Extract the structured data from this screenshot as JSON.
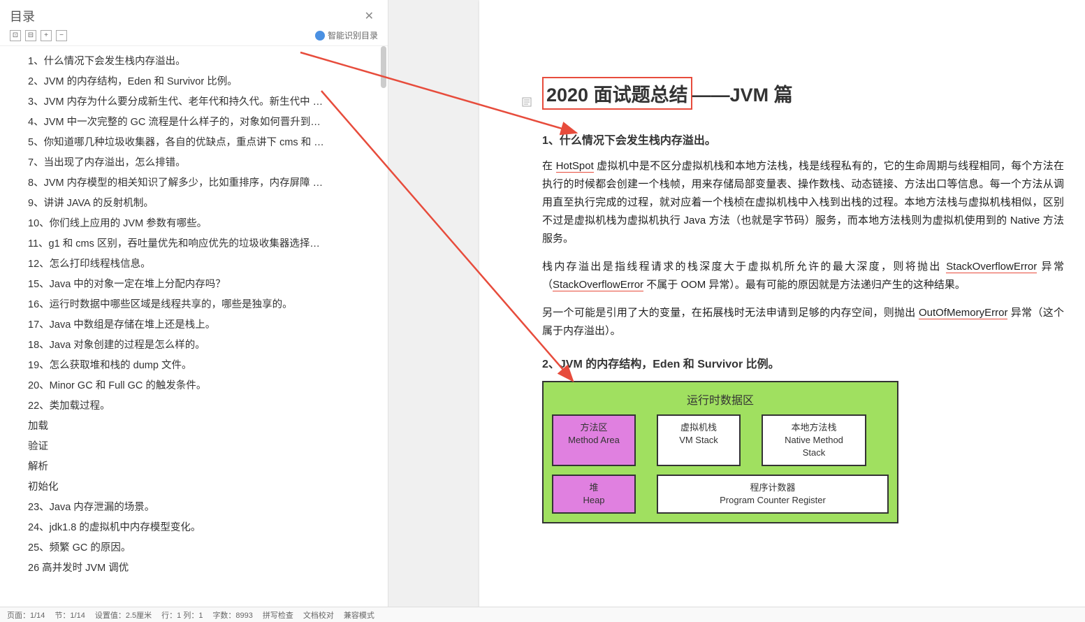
{
  "sidebar": {
    "title": "目录",
    "close": "✕",
    "expand_all": "⊡",
    "collapse_all": "⊟",
    "plus": "+",
    "minus": "−",
    "smart_toc": "智能识别目录",
    "items": [
      "1、什么情况下会发生栈内存溢出。",
      "2、JVM 的内存结构，Eden 和 Survivor 比例。",
      "3、JVM 内存为什么要分成新生代、老年代和持久代。新生代中 …",
      "4、JVM 中一次完整的 GC 流程是什么样子的，对象如何晋升到…",
      "5、你知道哪几种垃圾收集器，各自的优缺点，重点讲下 cms 和 …",
      "7、当出现了内存溢出，怎么排错。",
      "8、JVM 内存模型的相关知识了解多少，比如重排序，内存屏障 …",
      "9、讲讲 JAVA 的反射机制。",
      "10、你们线上应用的 JVM 参数有哪些。",
      "11、g1 和 cms 区别，吞吐量优先和响应优先的垃圾收集器选择…",
      "12、怎么打印线程栈信息。",
      "15、Java 中的对象一定在堆上分配内存吗？",
      "16、运行时数据中哪些区域是线程共享的，哪些是独享的。",
      "17、Java 中数组是存储在堆上还是栈上。",
      "18、Java 对象创建的过程是怎么样的。",
      "19、怎么获取堆和栈的 dump 文件。",
      "20、Minor GC 和 Full GC 的触发条件。",
      "22、类加载过程。",
      "加载",
      "验证",
      "解析",
      "初始化",
      "23、Java 内存泄漏的场景。",
      "24、jdk1.8 的虚拟机中内存模型变化。",
      "25、频繁 GC 的原因。",
      "26   高并发时   JVM 调优"
    ]
  },
  "document": {
    "title_boxed": "2020 面试题总结",
    "title_rest": "——JVM 篇",
    "h2_1": "1、什么情况下会发生栈内存溢出。",
    "p1": "在 HotSpot 虚拟机中是不区分虚拟机栈和本地方法栈，栈是线程私有的，它的生命周期与线程相同，每个方法在执行的时候都会创建一个栈帧，用来存储局部变量表、操作数栈、动态链接、方法出口等信息。每一个方法从调用直至执行完成的过程，就对应着一个栈桢在虚拟机栈中入栈到出栈的过程。本地方法栈与虚拟机栈相似，区别不过是虚拟机栈为虚拟机执行 Java 方法（也就是字节码）服务，而本地方法栈则为虚拟机使用到的 Native 方法服务。",
    "p2_a": "栈内存溢出是指线程请求的栈深度大于虚拟机所允许的最大深度，则将抛出 ",
    "p2_b": "StackOverflowError",
    "p2_c": " 异常（",
    "p2_d": "StackOverflowError",
    "p2_e": " 不属于 OOM 异常）。最有可能的原因就是方法递归产生的这种结果。",
    "p3_a": "另一个可能是引用了大的变量，在拓展栈时无法申请到足够的内存空间，则抛出 ",
    "p3_b": "OutOfMemoryError",
    "p3_c": " 异常（这个属于内存溢出）。",
    "h2_2": "2、JVM 的内存结构，Eden 和 Survivor 比例。",
    "hotspot": "HotSpot"
  },
  "diagram": {
    "title": "运行时数据区",
    "method_area_cn": "方法区",
    "method_area_en": "Method Area",
    "vm_stack_cn": "虚拟机栈",
    "vm_stack_en": "VM Stack",
    "native_cn": "本地方法栈",
    "native_en1": "Native Method",
    "native_en2": "Stack",
    "heap_cn": "堆",
    "heap_en": "Heap",
    "pc_cn": "程序计数器",
    "pc_en": "Program Counter Register"
  },
  "statusbar": {
    "page": "页面：1/14",
    "section": "节：1/14",
    "setting": "设置值：2.5厘米",
    "line": "行：1  列：1",
    "wordcount": "字数：8993",
    "spellcheck": "拼写检查",
    "doccheck": "文档校对",
    "comment": "兼容模式"
  }
}
